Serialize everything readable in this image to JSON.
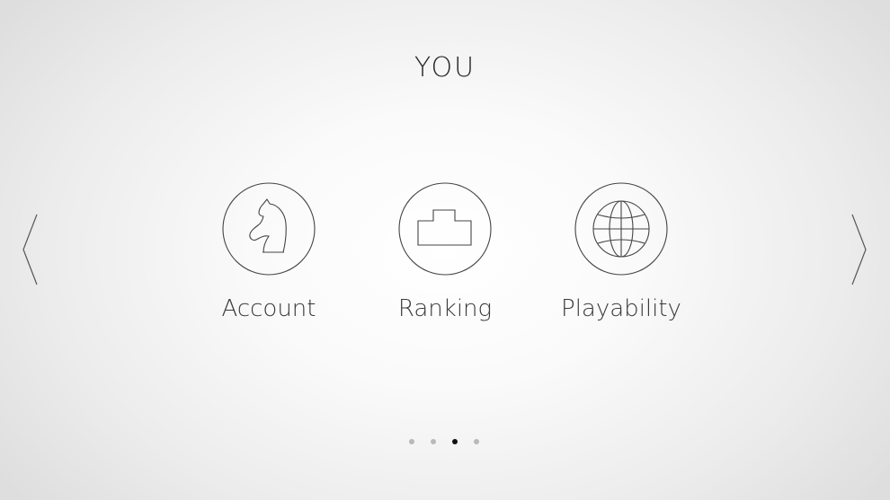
{
  "screen": {
    "title": "YOU"
  },
  "navigation": {
    "prev_icon": "chevron-left-icon",
    "next_icon": "chevron-right-icon"
  },
  "menu": {
    "items": [
      {
        "label": "Account",
        "icon": "knight-icon"
      },
      {
        "label": "Ranking",
        "icon": "podium-icon"
      },
      {
        "label": "Playability",
        "icon": "globe-icon"
      }
    ]
  },
  "pager": {
    "pages": 4,
    "active_page": 3
  },
  "colors": {
    "stroke": "#444444",
    "active_dot": "#111111",
    "inactive_dot": "#b9b9b9"
  }
}
